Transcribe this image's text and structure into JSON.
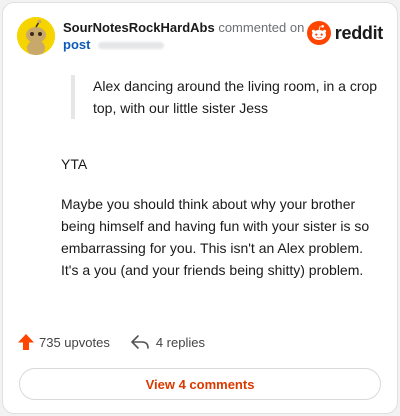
{
  "header": {
    "username": "SourNotesRockHardAbs",
    "action_text": "commented on",
    "post_link": "post",
    "brand_text": "reddit"
  },
  "quote": {
    "text": "Alex dancing around the living room, in a crop top, with our little sister Jess"
  },
  "comment": {
    "paragraphs": [
      "YTA",
      "Maybe you should think about why your brother being himself and having fun with your sister is so embarrassing for you. This isn't an Alex problem. It's a you (and your friends being shitty) problem."
    ]
  },
  "stats": {
    "upvotes": "735 upvotes",
    "replies": "4 replies"
  },
  "view_button": {
    "label": "View 4 comments"
  },
  "icons": {
    "avatar": "snoo-avatar-icon",
    "brand": "reddit-logo-icon",
    "upvote": "upvote-arrow-icon",
    "reply": "reply-arrow-icon"
  },
  "colors": {
    "brand": "#ff4500",
    "upvote": "#ff4500",
    "post_link": "#0e5bb5",
    "view_button_text": "#d93a00",
    "avatar_bg": "#f5d400"
  }
}
